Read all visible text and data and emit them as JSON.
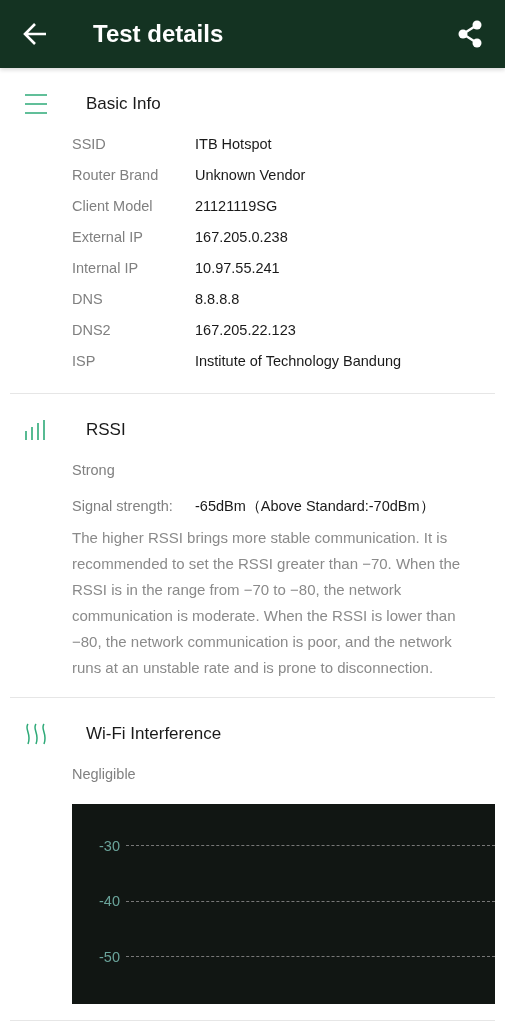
{
  "app_bar": {
    "title": "Test details"
  },
  "sections": [
    {
      "kind": "info",
      "title": "Basic Info",
      "body": [
        {
          "kind": "rows",
          "rows": [
            {
              "label": "SSID",
              "value": "ITB Hotspot"
            },
            {
              "label": "Router Brand",
              "value": "Unknown Vendor"
            },
            {
              "label": "Client Model",
              "value": "21121119SG"
            },
            {
              "label": "External IP",
              "value": "167.205.0.238"
            },
            {
              "label": "Internal IP",
              "value": "10.97.55.241"
            },
            {
              "label": "DNS",
              "value": "8.8.8.8"
            },
            {
              "label": "DNS2",
              "value": "167.205.22.123"
            },
            {
              "label": "ISP",
              "value": "Institute of Technology Bandung"
            }
          ]
        }
      ]
    },
    {
      "kind": "signal",
      "title": "RSSI",
      "body": [
        {
          "kind": "status",
          "text": "Strong"
        },
        {
          "kind": "pair",
          "label": "Signal strength:",
          "value": "-65dBm（Above Standard:-70dBm）"
        },
        {
          "kind": "paragraph",
          "text": "The higher RSSI brings more stable communication. It is recommended to set the RSSI greater than −70. When the RSSI is in the range from −70 to −80, the network communication is moderate. When the RSSI is lower than −80, the network communication is poor, and the network runs at an unstable rate and is prone to disconnection."
        }
      ]
    },
    {
      "kind": "interference",
      "title": "Wi-Fi Interference",
      "body": [
        {
          "kind": "status",
          "text": "Negligible"
        },
        {
          "kind": "chart",
          "y_labels": [
            "-30",
            "-40",
            "-50"
          ]
        }
      ]
    }
  ]
}
